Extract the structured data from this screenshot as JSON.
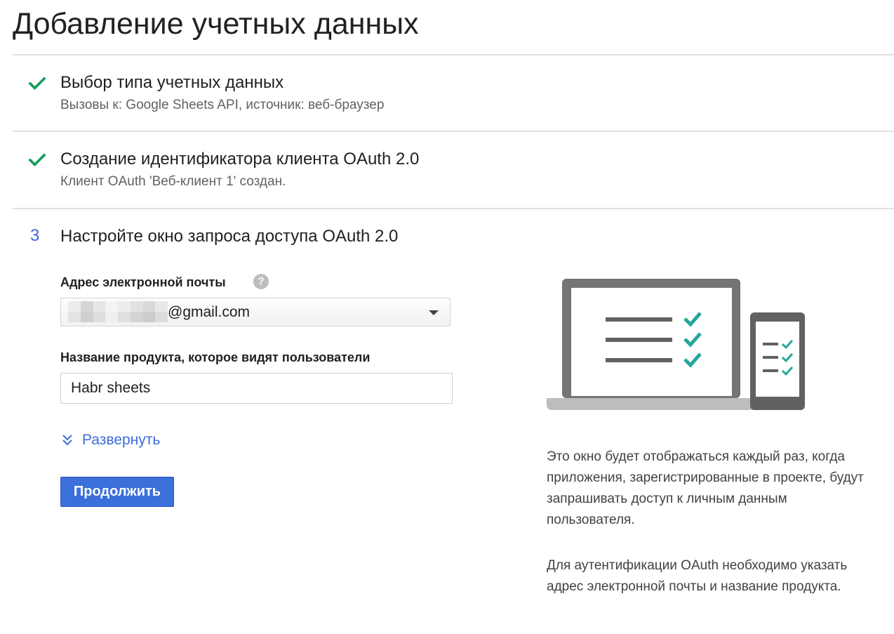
{
  "page": {
    "title": "Добавление учетных данных"
  },
  "steps": [
    {
      "status": "done",
      "marker_icon": "check-icon",
      "title": "Выбор типа учетных данных",
      "subtitle": "Вызовы к: Google Sheets API, источник: веб-браузер"
    },
    {
      "status": "done",
      "marker_icon": "check-icon",
      "title": "Создание идентификатора клиента OAuth 2.0",
      "subtitle": "Клиент OAuth 'Веб-клиент 1' создан."
    },
    {
      "status": "active",
      "number": "3",
      "title": "Настройте окно запроса доступа OAuth 2.0"
    }
  ],
  "form": {
    "email_label": "Адрес электронной почты",
    "help_icon": "?",
    "email_value": "@gmail.com",
    "product_label": "Название продукта, которое видят пользователи",
    "product_value": "Habr sheets",
    "expand_label": "Развернуть",
    "continue_label": "Продолжить"
  },
  "info": {
    "paragraph_1": "Это окно будет отображаться каждый раз, когда приложения, зарегистрированные в проекте, будут запрашивать доступ к личным данным пользователя.",
    "paragraph_2": "Для аутентификации OAuth необходимо указать адрес электронной почты и название продукта."
  },
  "colors": {
    "accent_blue": "#3b6cd8",
    "check_green": "#0f9d58",
    "illustration_teal": "#26a69a",
    "divider": "#e0e0e0"
  }
}
